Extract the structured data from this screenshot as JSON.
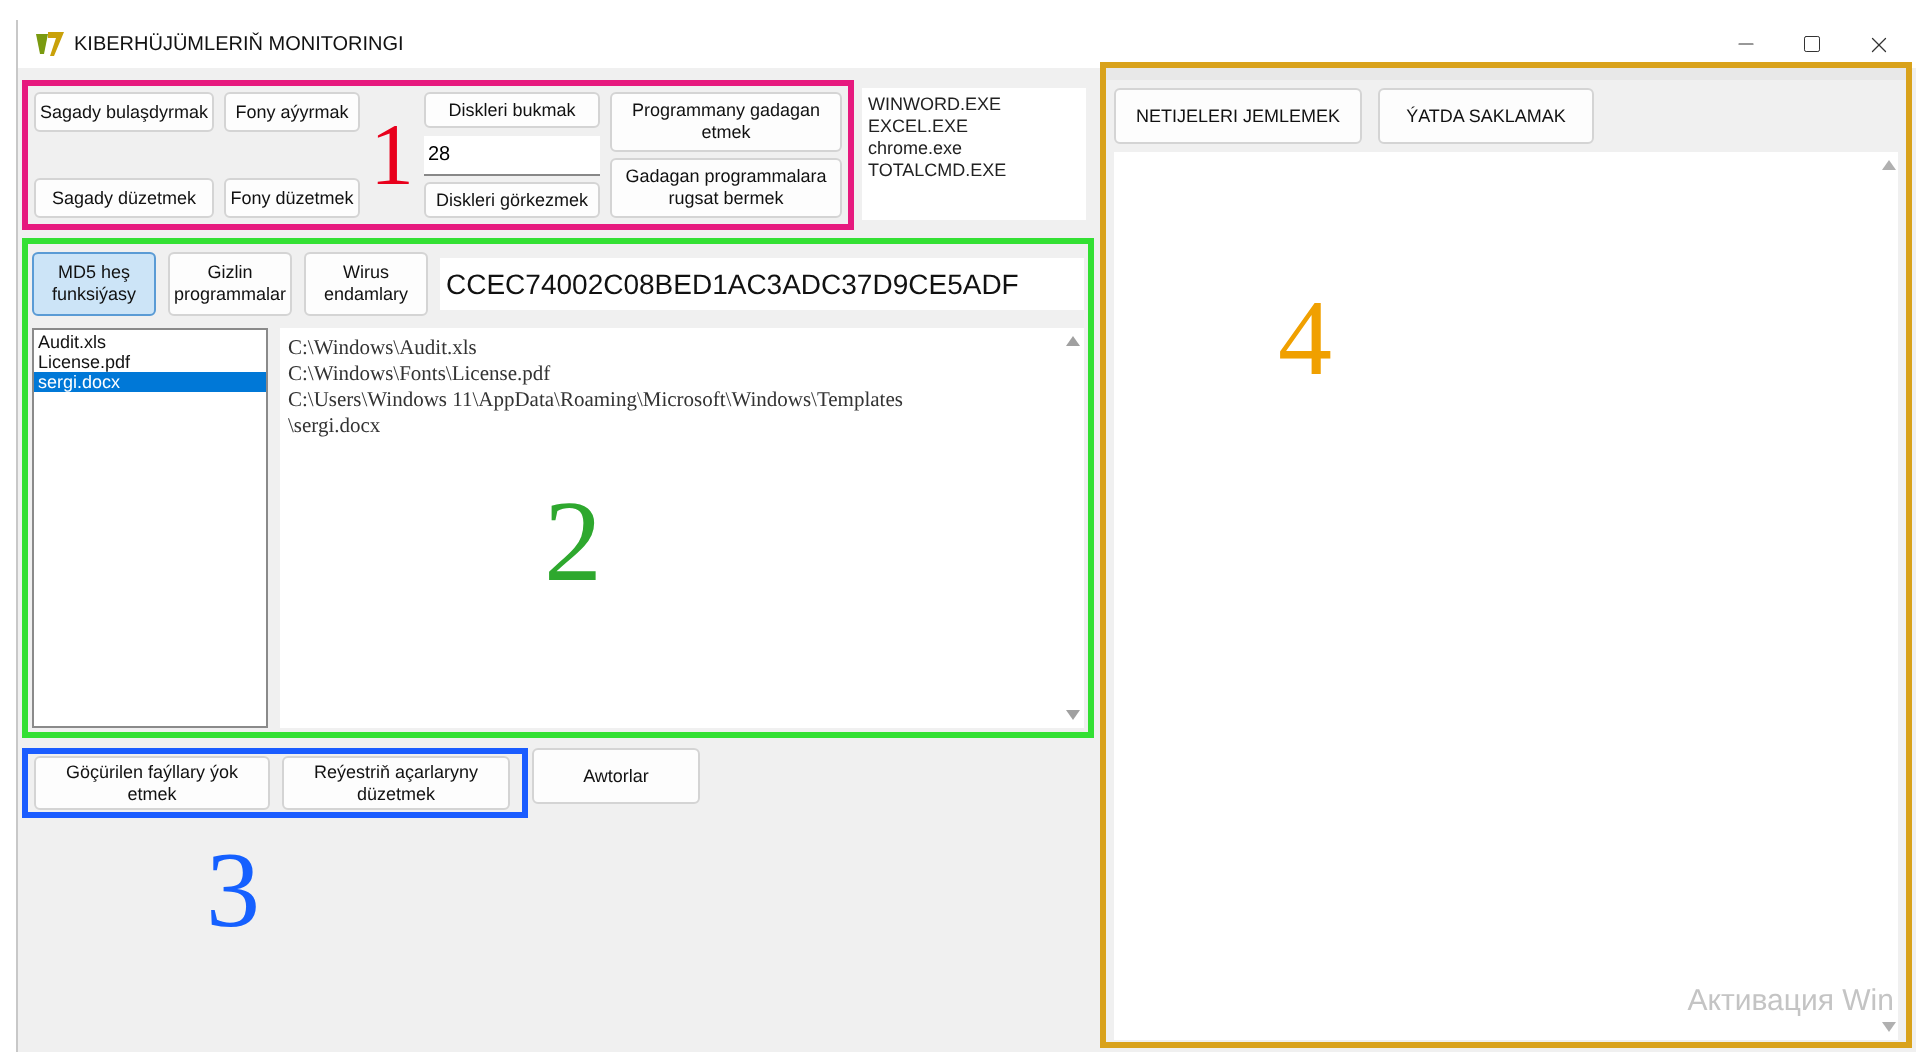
{
  "window": {
    "title": "KIBERHÜJÜMLERIŇ MONITORINGI"
  },
  "section_1": {
    "annotation": {
      "label": "1",
      "color": "#e8001c"
    },
    "frame": {
      "color": "#e6197e"
    },
    "clock_buttons": [
      "Sagady bulaşdyrmak",
      "Sagady düzetmek"
    ],
    "background_buttons": [
      "Fony aýyrmak",
      "Fony düzetmek"
    ],
    "disk_hide_button": "Diskleri bukmak",
    "disk_field": {
      "value": "28"
    },
    "disk_show_button": "Diskleri görkezmek",
    "program_buttons": [
      "Programmany gadagan etmek",
      "Gadagan programmalara rugsat bermek"
    ],
    "process_list": [
      "WINWORD.EXE",
      "EXCEL.EXE",
      "chrome.exe",
      "TOTALCMD.EXE"
    ]
  },
  "section_2": {
    "annotation": {
      "label": "2",
      "color": "#2ea82e"
    },
    "frame": {
      "color": "#33e033"
    },
    "tabs": [
      {
        "label": "MD5 heş funksiýasy",
        "selected": true
      },
      {
        "label": "Gizlin programmalar",
        "selected": false
      },
      {
        "label": "Wirus endamlary",
        "selected": false
      }
    ],
    "hash_field": {
      "value": "CCEC74002C08BED1AC3ADC37D9CE5ADF"
    },
    "file_list": [
      {
        "name": "Audit.xls",
        "selected": false
      },
      {
        "name": "License.pdf",
        "selected": false
      },
      {
        "name": "sergi.docx",
        "selected": true
      }
    ],
    "path_lines": [
      "C:\\Windows\\Audit.xls",
      "C:\\Windows\\Fonts\\License.pdf",
      "C:\\Users\\Windows 11\\AppData\\Roaming\\Microsoft\\Windows\\Templates",
      "\\sergi.docx"
    ]
  },
  "section_3": {
    "annotation": {
      "label": "3",
      "color": "#1560ff"
    },
    "frame": {
      "color": "#1a5cff"
    },
    "framed_buttons": [
      "Göçürilen faýllary ýok etmek",
      "Reýestriň açarlaryny düzetmek"
    ],
    "authors_button": "Awtorlar"
  },
  "results_panel": {
    "annotation": {
      "label": "4",
      "color": "#f0a000"
    },
    "frame": {
      "color": "#d9a21b"
    },
    "buttons": [
      "NETIJELERI JEMLEMEK",
      "ÝATDA SAKLAMAK"
    ],
    "activation_notice": "Активация Win"
  }
}
